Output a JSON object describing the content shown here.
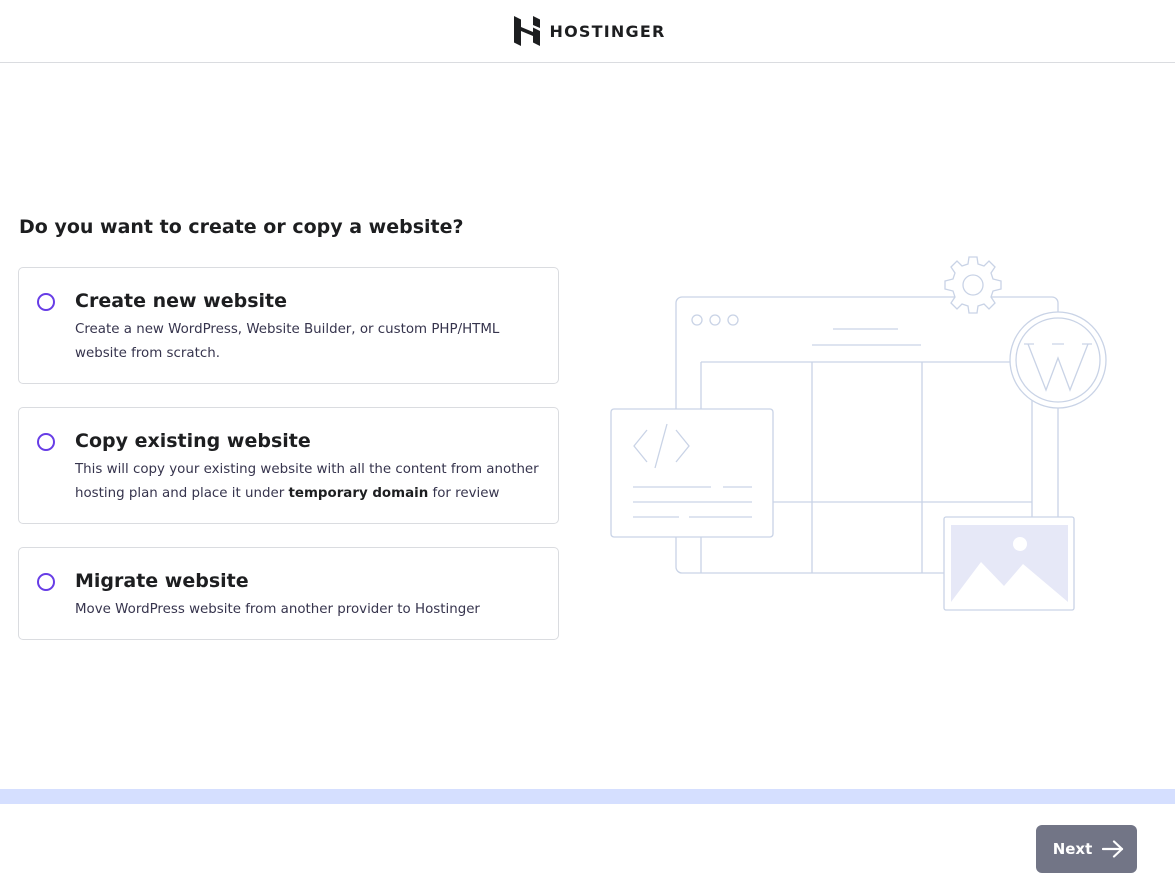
{
  "header": {
    "brand": "HOSTINGER",
    "logo_icon": "hostinger-h-logo-icon"
  },
  "question": "Do you want to create or copy a website?",
  "options": [
    {
      "title": "Create new website",
      "description": "Create a new WordPress, Website Builder, or custom PHP/HTML website from scratch.",
      "selected": false
    },
    {
      "title": "Copy existing website",
      "description_before": "This will copy your existing website with all the content from another hosting plan and place it under ",
      "description_bold": "temporary domain",
      "description_after": " for review",
      "selected": false
    },
    {
      "title": "Migrate website",
      "description": "Move WordPress website from another provider to Hostinger",
      "selected": false
    }
  ],
  "illustration": {
    "icons": [
      "browser-window-icon",
      "gear-icon",
      "wordpress-logo-icon",
      "code-brackets-icon",
      "image-placeholder-icon"
    ]
  },
  "footer": {
    "next_label": "Next",
    "next_icon": "arrow-right-icon"
  },
  "colors": {
    "accent": "#673de6",
    "next_button_bg": "#727586",
    "progress_track": "#d5dfff",
    "border": "#dadce0",
    "illustration_line": "#c9d3e6",
    "image_fill": "#e6e8f7"
  }
}
